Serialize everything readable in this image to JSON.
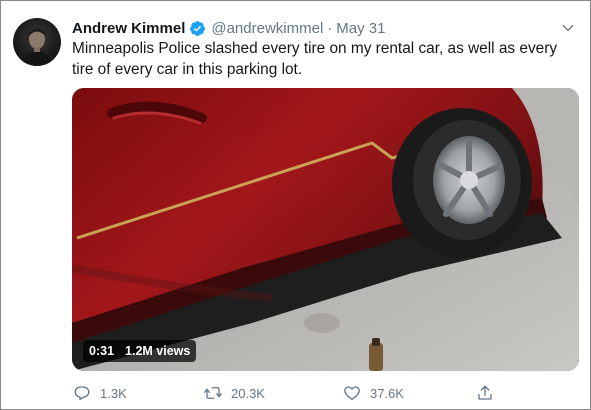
{
  "tweet": {
    "author_name": "Andrew Kimmel",
    "handle": "@andrewkimmel",
    "separator": "·",
    "date": "May 31",
    "text": "Minneapolis Police slashed every tire on my rental car, as well as every tire of every car in this parking lot.",
    "verified": true
  },
  "media": {
    "type": "video",
    "duration": "0:31",
    "views": "1.2M views"
  },
  "actions": {
    "reply": {
      "icon": "reply-icon",
      "count": "1.3K"
    },
    "retweet": {
      "icon": "retweet-icon",
      "count": "20.3K"
    },
    "like": {
      "icon": "heart-icon",
      "count": "37.6K"
    },
    "share": {
      "icon": "share-icon"
    }
  },
  "colors": {
    "text_primary": "#14171a",
    "text_secondary": "#657786",
    "verified_blue": "#1da1f2",
    "border": "#8a8a8a"
  }
}
